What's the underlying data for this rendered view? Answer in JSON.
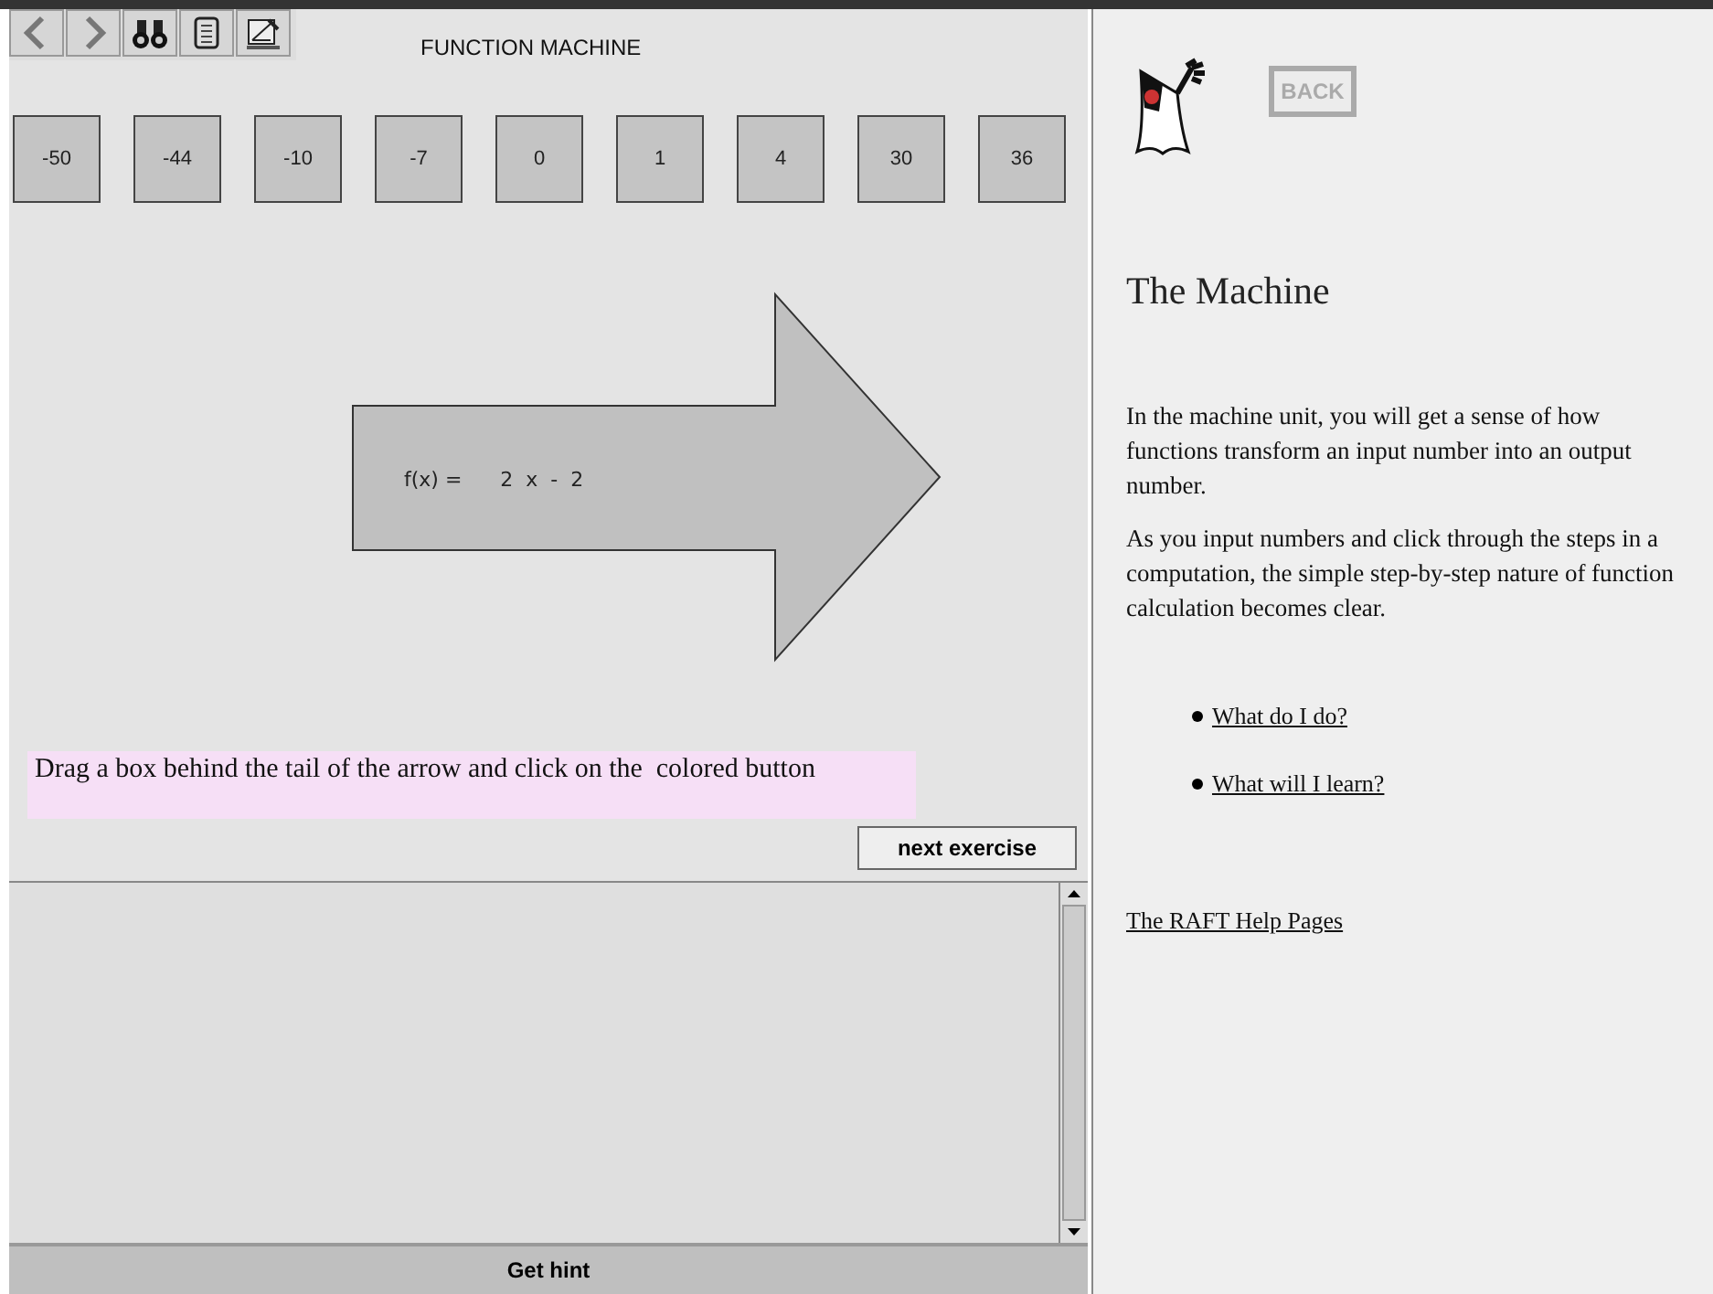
{
  "toolbar": {
    "buttons": [
      {
        "kind": "back"
      },
      {
        "kind": "forward"
      },
      {
        "kind": "find"
      },
      {
        "kind": "notes"
      },
      {
        "kind": "tools"
      }
    ]
  },
  "machine": {
    "title": "FUNCTION MACHINE",
    "inputs": [
      "-50",
      "-44",
      "-10",
      "-7",
      "0",
      "1",
      "4",
      "30",
      "36"
    ],
    "formula": "f(x) =      2  x  -  2",
    "instruction": "Drag a box behind the tail of the arrow and click on the  colored button",
    "next_button": "next exercise",
    "hint_button": "Get hint"
  },
  "help": {
    "back_button": "BACK",
    "back_disabled": true,
    "heading": "The Machine",
    "paragraphs": [
      "In the machine unit, you will get a sense of how functions transform an input number into an output number.",
      "As you input numbers and click through the steps in a computation, the simple step-by-step nature of function calculation becomes clear."
    ],
    "links": [
      "What do I do?",
      "What will I learn?"
    ],
    "footer_link": "The RAFT Help Pages"
  }
}
